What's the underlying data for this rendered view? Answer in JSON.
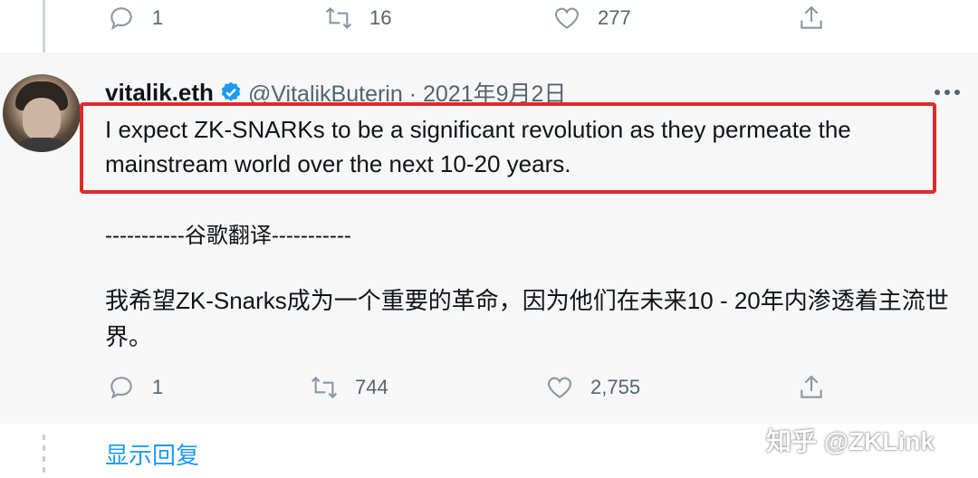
{
  "previous_tweet": {
    "reply_count": "1",
    "retweet_count": "16",
    "like_count": "277"
  },
  "tweet": {
    "display_name": "vitalik.eth",
    "handle_date": "@VitalikButerin · 2021年9月2日",
    "text": "I expect ZK-SNARKs to be a significant revolution as they permeate the mainstream world over the next 10-20 years.",
    "translation_divider": "-----------谷歌翻译-----------",
    "translation": "我希望ZK-Snarks成为一个重要的革命，因为他们在未来10  -  20年内渗透着主流世界。",
    "reply_count": "1",
    "retweet_count": "744",
    "like_count": "2,755"
  },
  "show_replies_label": "显示回复",
  "watermark": "知乎 @ZKLink",
  "colors": {
    "accent": "#1d9bf0",
    "highlight_border": "#e02a2a",
    "muted": "#536471",
    "panel_bg": "#f7f7f7"
  },
  "icons": [
    "reply-icon",
    "retweet-icon",
    "like-icon",
    "share-icon",
    "verified-icon",
    "more-icon"
  ]
}
